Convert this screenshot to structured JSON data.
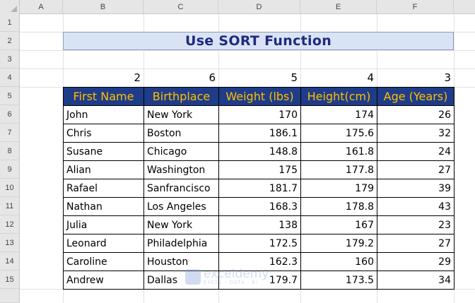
{
  "columns": [
    "A",
    "B",
    "C",
    "D",
    "E",
    "F"
  ],
  "rows": [
    "1",
    "2",
    "3",
    "4",
    "5",
    "6",
    "7",
    "8",
    "9",
    "10",
    "11",
    "12",
    "13",
    "14",
    "15"
  ],
  "title": "Use SORT Function",
  "sort_index": [
    "2",
    "6",
    "5",
    "4",
    "3"
  ],
  "headers": [
    "First Name",
    "Birthplace",
    "Weight (lbs)",
    "Height(cm)",
    "Age (Years)"
  ],
  "data": [
    [
      "John",
      "New York",
      "170",
      "174",
      "26"
    ],
    [
      "Chris",
      "Boston",
      "186.1",
      "175.6",
      "32"
    ],
    [
      "Susane",
      "Chicago",
      "148.8",
      "161.8",
      "24"
    ],
    [
      "Alian",
      "Washington",
      "175",
      "177.8",
      "27"
    ],
    [
      "Rafael",
      "Sanfrancisco",
      "181.7",
      "179",
      "39"
    ],
    [
      "Nathan",
      "Los Angeles",
      "168.3",
      "178.8",
      "43"
    ],
    [
      "Julia",
      "New York",
      "138",
      "167",
      "23"
    ],
    [
      "Leonard",
      "Philadelphia",
      "172.5",
      "179.2",
      "27"
    ],
    [
      "Caroline",
      "Houston",
      "162.3",
      "160",
      "29"
    ],
    [
      "Andrew",
      "Dallas",
      "179.7",
      "173.5",
      "34"
    ]
  ],
  "watermark": {
    "brand": "exceldemy",
    "tagline": "EXCEL · DATA · BI"
  },
  "colors": {
    "header_bg": "#1f3c88",
    "header_text": "#ffc000",
    "title_bg": "#dae3f3",
    "title_text": "#1f2a80"
  }
}
